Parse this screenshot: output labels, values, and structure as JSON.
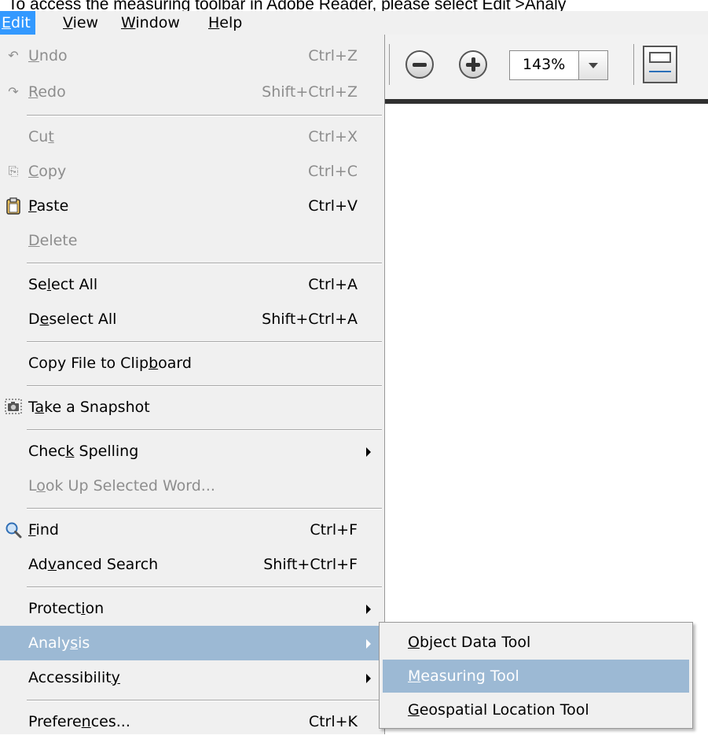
{
  "caption": "To access the measuring toolbar in Adobe Reader, please select Edit >Analy",
  "menubar": {
    "items": [
      {
        "pre": "",
        "key": "E",
        "post": "dit"
      },
      {
        "pre": "",
        "key": "V",
        "post": "iew"
      },
      {
        "pre": "",
        "key": "W",
        "post": "indow"
      },
      {
        "pre": "",
        "key": "H",
        "post": "elp"
      }
    ]
  },
  "toolbar": {
    "zoom": "143%"
  },
  "edit_menu": {
    "items": [
      {
        "pre": "",
        "key": "U",
        "post": "ndo",
        "shortcut": "Ctrl+Z"
      },
      {
        "pre": "",
        "key": "R",
        "post": "edo",
        "shortcut": "Shift+Ctrl+Z"
      },
      {
        "pre": "Cu",
        "key": "t",
        "post": "",
        "shortcut": "Ctrl+X"
      },
      {
        "pre": "",
        "key": "C",
        "post": "opy",
        "shortcut": "Ctrl+C"
      },
      {
        "pre": "",
        "key": "P",
        "post": "aste",
        "shortcut": "Ctrl+V"
      },
      {
        "pre": "",
        "key": "D",
        "post": "elete",
        "shortcut": ""
      },
      {
        "pre": "Se",
        "key": "l",
        "post": "ect All",
        "shortcut": "Ctrl+A"
      },
      {
        "pre": "D",
        "key": "e",
        "post": "select All",
        "shortcut": "Shift+Ctrl+A"
      },
      {
        "pre": "Copy File to Clip",
        "key": "b",
        "post": "oard",
        "shortcut": ""
      },
      {
        "pre": "T",
        "key": "a",
        "post": "ke a Snapshot",
        "shortcut": ""
      },
      {
        "pre": "Chec",
        "key": "k",
        "post": " Spelling",
        "shortcut": ""
      },
      {
        "pre": "L",
        "key": "o",
        "post": "ok Up Selected Word...",
        "shortcut": ""
      },
      {
        "pre": "",
        "key": "F",
        "post": "ind",
        "shortcut": "Ctrl+F"
      },
      {
        "pre": "Ad",
        "key": "v",
        "post": "anced Search",
        "shortcut": "Shift+Ctrl+F"
      },
      {
        "pre": "Protect",
        "key": "i",
        "post": "on",
        "shortcut": ""
      },
      {
        "pre": "Analy",
        "key": "s",
        "post": "is",
        "shortcut": ""
      },
      {
        "pre": "Accessibilit",
        "key": "y",
        "post": "",
        "shortcut": ""
      },
      {
        "pre": "Prefere",
        "key": "n",
        "post": "ces...",
        "shortcut": "Ctrl+K"
      }
    ]
  },
  "analysis_submenu": {
    "items": [
      {
        "pre": "",
        "key": "O",
        "post": "bject Data Tool"
      },
      {
        "pre": "",
        "key": "M",
        "post": "easuring Tool"
      },
      {
        "pre": "",
        "key": "G",
        "post": "eospatial Location Tool"
      }
    ]
  }
}
